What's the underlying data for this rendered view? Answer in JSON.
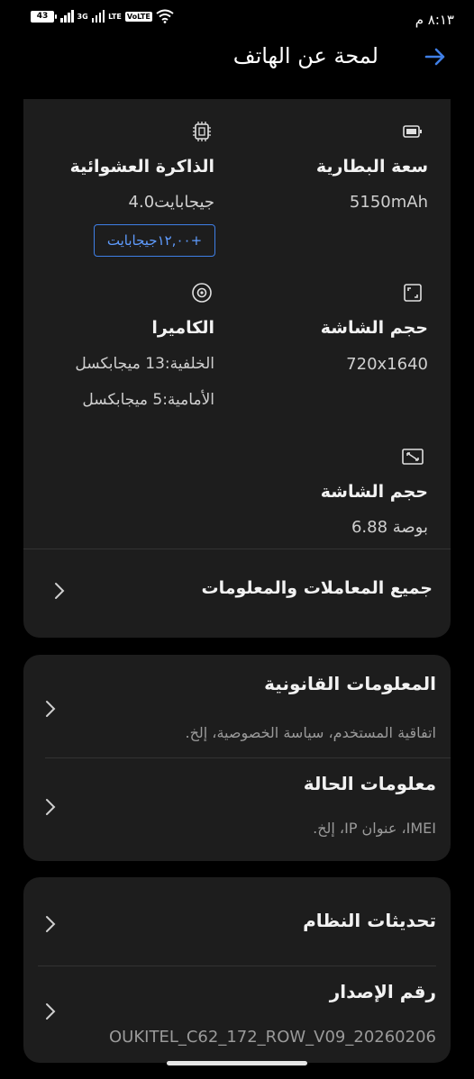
{
  "status_bar": {
    "time": "٨:١٣ م",
    "battery_level": "43",
    "network_3g": "3G",
    "network_lte": "LTE",
    "volte": "VoLTE",
    "icons": [
      "battery-icon",
      "signal-icon",
      "wifi-icon"
    ]
  },
  "header": {
    "title": "لمحة عن الهاتف",
    "back_icon": "arrow-right-icon",
    "accent_color": "#3f7fe6"
  },
  "specs": {
    "battery": {
      "title": "سعة البطارية",
      "value": "5150mAh",
      "icon": "battery-icon"
    },
    "ram": {
      "title": "الذاكرة العشوائية",
      "value": "4.0جيجابايت",
      "upgrade": "+١٢,٠٠جيجابايت",
      "icon": "chip-icon"
    },
    "resolution": {
      "title": "حجم الشاشة",
      "value": "720x1640",
      "icon": "screen-resolution-icon"
    },
    "camera": {
      "title": "الكاميرا",
      "rear": "الخلفية:13 ميجابكسل",
      "front": "الأمامية:5 ميجابكسل",
      "icon": "camera-icon"
    },
    "screen_size": {
      "title": "حجم الشاشة",
      "value": "6.88 بوصة",
      "icon": "screen-size-icon"
    },
    "all_params": "جميع المعاملات والمعلومات"
  },
  "info": {
    "legal": {
      "title": "المعلومات القانونية",
      "subtitle": "اتفاقية المستخدم، سياسة الخصوصية، إلخ."
    },
    "status": {
      "title": "معلومات الحالة",
      "subtitle": "IMEI، عنوان IP، إلخ."
    }
  },
  "system": {
    "updates": {
      "title": "تحديثات النظام"
    },
    "build": {
      "title": "رقم الإصدار",
      "value": "OUKITEL_C62_172_ROW_V09_20260206"
    }
  }
}
